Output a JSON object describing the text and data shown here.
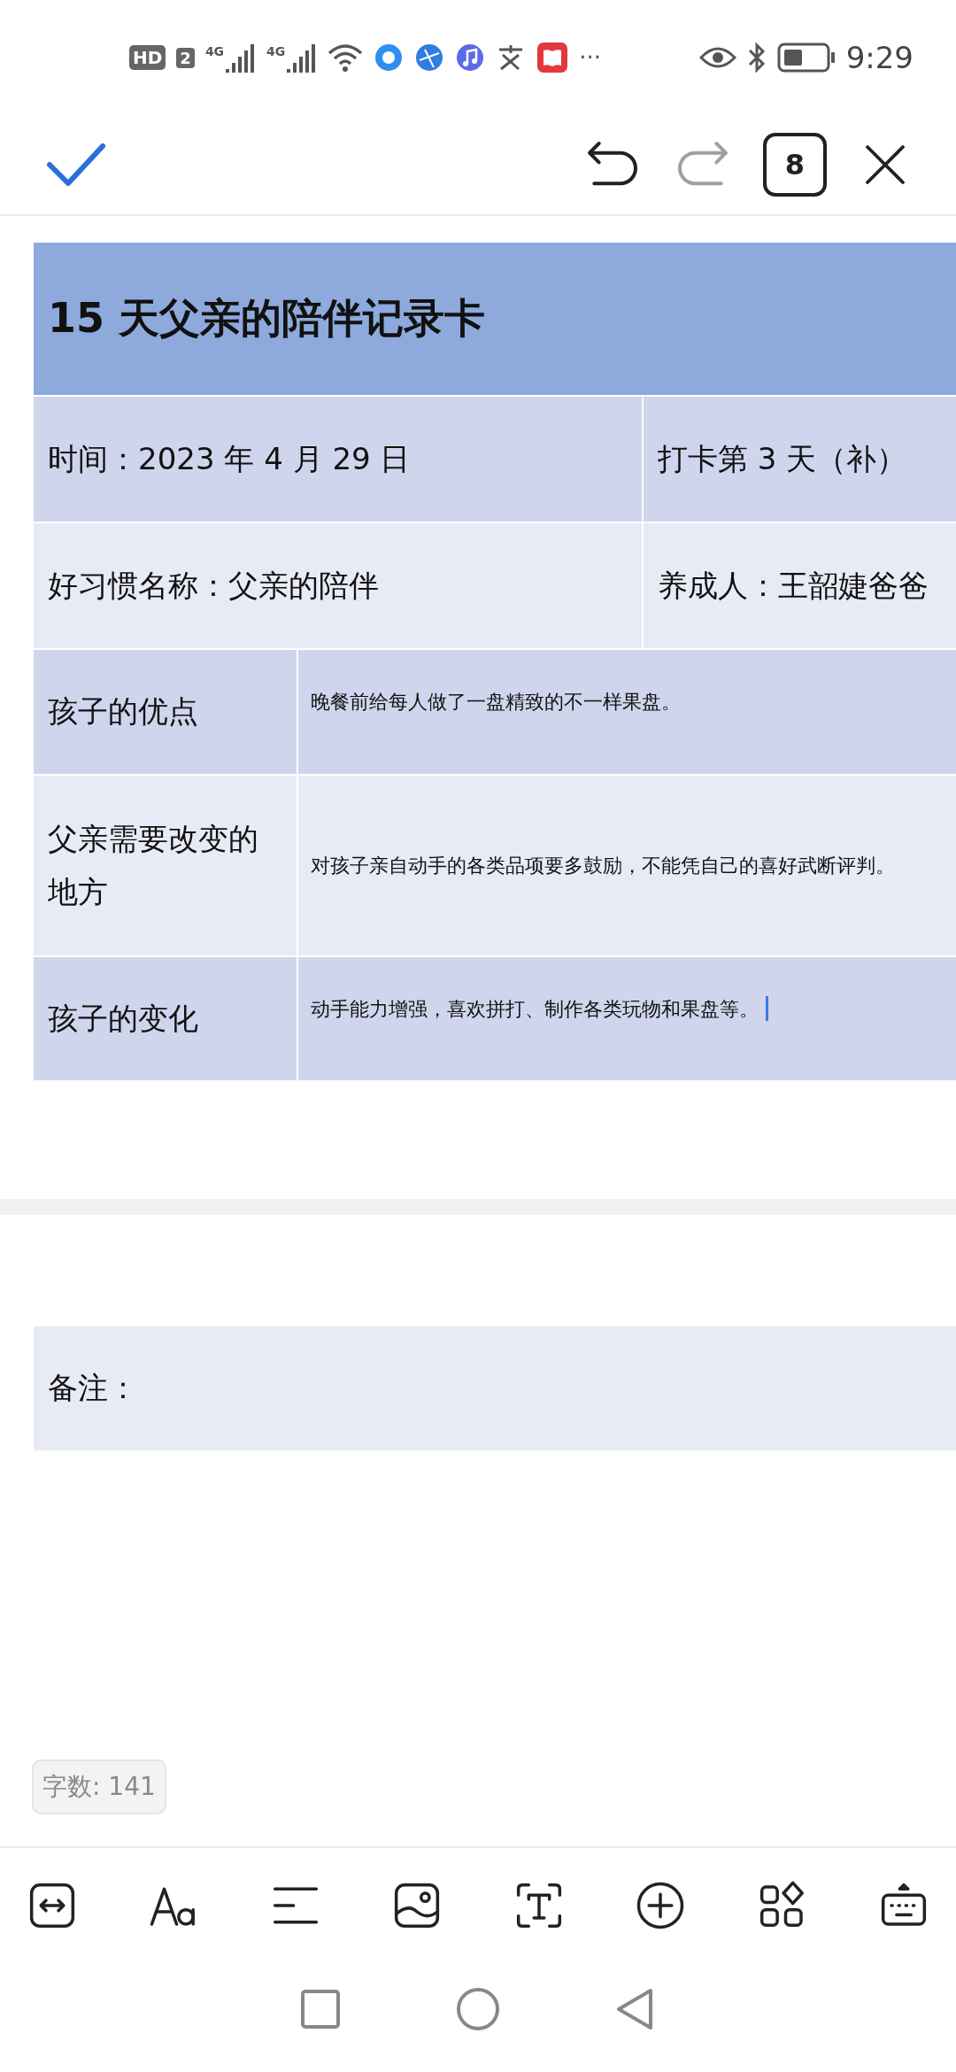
{
  "status_bar": {
    "hd": "HD",
    "sim": "2",
    "networks": [
      "4G",
      "4G"
    ],
    "more": "···",
    "time": "9:29"
  },
  "top_bar": {
    "undo_disabled": false,
    "redo_disabled": true,
    "page_count": "8"
  },
  "document": {
    "title": "15 天父亲的陪伴记录卡",
    "info_rows": [
      {
        "left": "时间：2023 年 4 月 29 日",
        "right": "打卡第 3 天（补）"
      },
      {
        "left": "好习惯名称：父亲的陪伴",
        "right": "养成人：王韶婕爸爸"
      }
    ],
    "detail_rows": [
      {
        "label": "孩子的优点",
        "text": "晚餐前给每人做了一盘精致的不一样果盘。",
        "cursor": false
      },
      {
        "label": "父亲需要改变的地方",
        "text": "对孩子亲自动手的各类品项要多鼓励，不能凭自己的喜好武断评判。",
        "cursor": false
      },
      {
        "label": "孩子的变化",
        "text": "动手能力增强，喜欢拼打、制作各类玩物和果盘等。",
        "cursor": true
      }
    ],
    "notes_label": "备注："
  },
  "word_count": "字数: 141"
}
